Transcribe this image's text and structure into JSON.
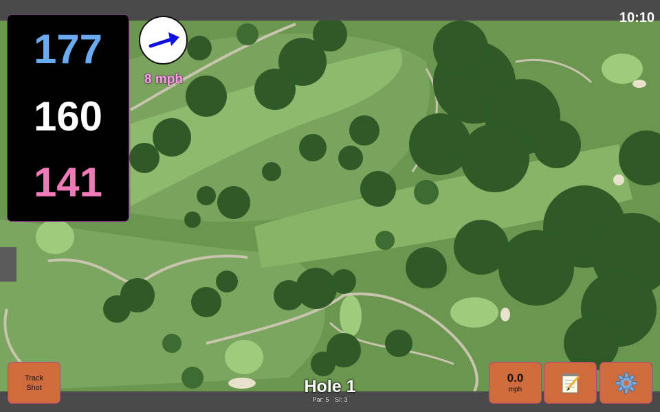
{
  "status": {
    "time": "10:10"
  },
  "distances": {
    "back": "177",
    "middle": "160",
    "front": "141"
  },
  "wind": {
    "speed_label": "8 mph",
    "icon": "wind-arrow-icon"
  },
  "hole": {
    "title": "Hole 1",
    "par_label": "Par: 5",
    "si_label": "SI: 3"
  },
  "buttons": {
    "track_shot_line1": "Track",
    "track_shot_line2": "Shot",
    "speed_value": "0.0",
    "speed_unit": "mph",
    "notes_icon": "notepad-icon",
    "settings_icon": "gear-icon"
  },
  "colors": {
    "back_distance": "#6aaaf0",
    "middle_distance": "#ffffff",
    "front_distance": "#f07ab8",
    "button": "#cf6c3e",
    "bar": "#4a4a4a"
  }
}
